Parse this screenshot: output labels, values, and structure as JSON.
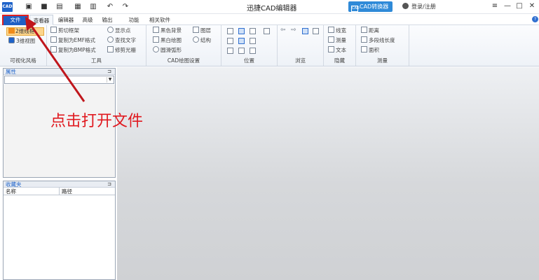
{
  "titlebar": {
    "logo": "CAD",
    "title": "迅捷CAD编辑器",
    "cad_converter": "CAD转换器",
    "cad_converter_icon": "CAD",
    "login": "登录/注册",
    "quick_access_icons": [
      "new-file-icon",
      "open-folder-icon",
      "save-icon",
      "pdf-icon",
      "print-icon",
      "undo-icon",
      "redo-icon"
    ],
    "window_buttons": [
      "≡",
      "—",
      "□",
      "✕"
    ]
  },
  "menu": {
    "tabs": [
      "文件",
      "查看器",
      "编辑器",
      "高级",
      "输出",
      "功能",
      "相关软件"
    ],
    "help": "?"
  },
  "ribbon": {
    "visual_style": {
      "label": "可视化风格",
      "view2d": "2维线框",
      "view3d": "3维视图"
    },
    "tools": {
      "label": "工具",
      "items": [
        "剪切框架",
        "复制为EMF格式",
        "复制为BMP格式",
        "显示点",
        "查找文字",
        "修剪光栅"
      ]
    },
    "cad_settings": {
      "label": "CAD绘图设置",
      "items": [
        "黑色背景",
        "黑白绘图",
        "圆滑弧形",
        "图层",
        "结构"
      ]
    },
    "position": {
      "label": "位置"
    },
    "browse": {
      "label": "浏览"
    },
    "hide": {
      "label": "隐藏",
      "items": [
        "线宽",
        "测量",
        "文本"
      ]
    },
    "measure": {
      "label": "测量",
      "items": [
        "距离",
        "多段线长度",
        "面积"
      ]
    }
  },
  "properties_panel": {
    "title": "属性",
    "pin": "⊐"
  },
  "favorites_panel": {
    "title": "收藏夹",
    "pin": "⊐",
    "columns": [
      "名称",
      "路径"
    ]
  },
  "annotation": {
    "text": "点击打开文件",
    "color": "#e0191f"
  },
  "colors": {
    "accent": "#1f63c9",
    "cad_button": "#2f8ad8",
    "highlight": "#fcd58c"
  }
}
